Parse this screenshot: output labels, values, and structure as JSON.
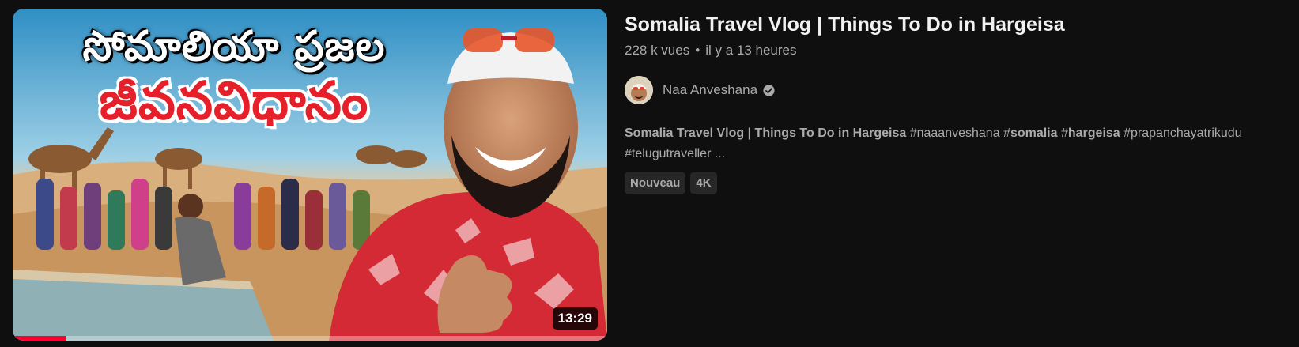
{
  "video": {
    "title": "Somalia Travel Vlog | Things To Do in Hargeisa",
    "views": "228 k vues",
    "separator": "•",
    "age": "il y a 13 heures",
    "duration": "13:29",
    "progress_fraction": 0.09,
    "thumbnail": {
      "line1": "సోమాలియా ప్రజల",
      "line2": "జీవనవిధానం"
    }
  },
  "channel": {
    "name": "Naa Anveshana",
    "verified_icon": "verified-check-icon"
  },
  "description": {
    "segments": [
      {
        "text": "Somalia Travel Vlog | Things To Do in Hargeisa",
        "bold": true
      },
      {
        "text": " #naaanveshana #",
        "bold": false
      },
      {
        "text": "somalia",
        "bold": true
      },
      {
        "text": " #",
        "bold": false
      },
      {
        "text": "hargeisa",
        "bold": true
      },
      {
        "text": " #prapanchayatrikudu #telugutraveller ...",
        "bold": false
      }
    ]
  },
  "badges": [
    "Nouveau",
    "4K"
  ],
  "colors": {
    "background": "#0f0f0f",
    "progress": "#ff0033",
    "badge_bg": "#272727"
  }
}
